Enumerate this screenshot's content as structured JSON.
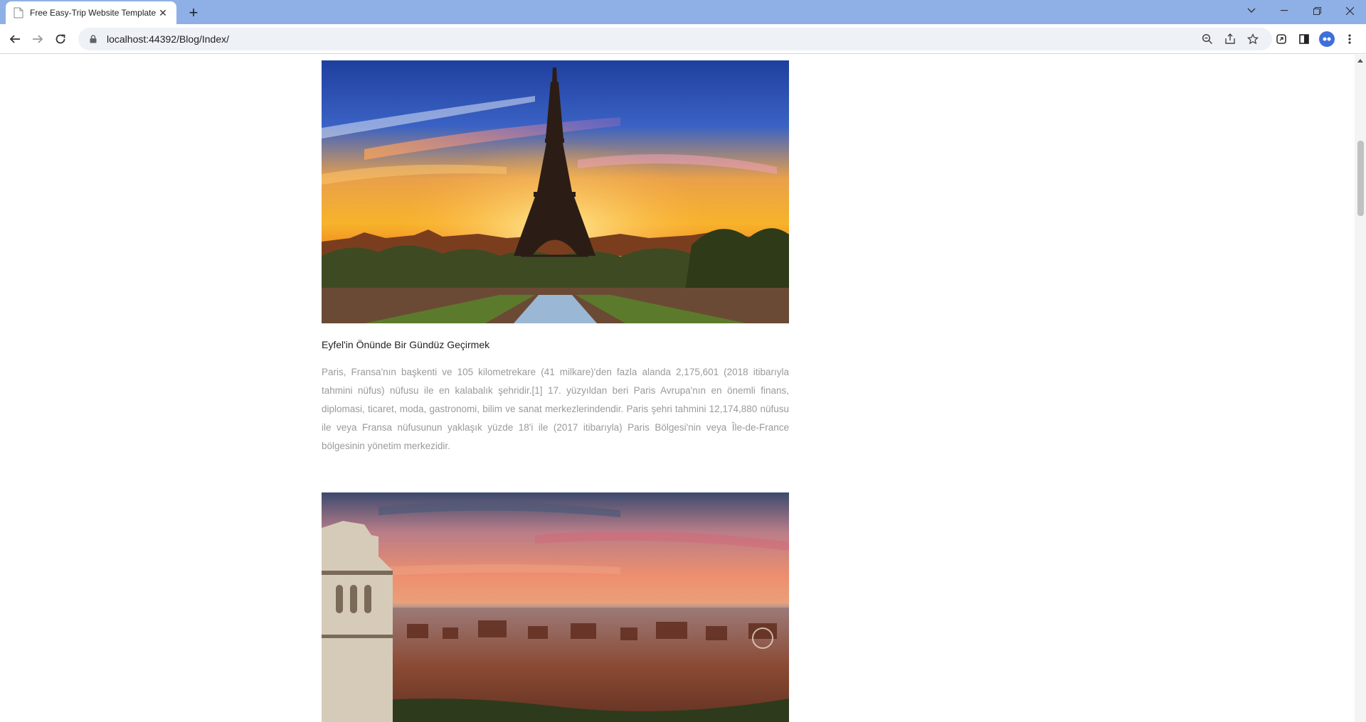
{
  "browser": {
    "tab_title": "Free Easy-Trip Website Template",
    "url": "localhost:44392/Blog/Index/",
    "icons": [
      "favicon-icon",
      "close-icon",
      "plus-icon",
      "chevron-down-icon",
      "minimize-icon",
      "restore-icon",
      "close-window-icon",
      "back-icon",
      "forward-icon",
      "reload-icon",
      "lock-icon",
      "zoom-icon",
      "share-icon",
      "star-icon",
      "extensions-icon",
      "side-panel-icon",
      "profile-icon",
      "menu-icon"
    ]
  },
  "posts": [
    {
      "title": "Eyfel'in Önünde Bir Gündüz Geçirmek",
      "text": "Paris, Fransa'nın başkenti ve 105 kilometrekare (41 milkare)'den fazla alanda 2,175,601 (2018 itibarıyla tahmini nüfus) nüfusu ile en kalabalık şehridir.[1] 17. yüzyıldan beri Paris Avrupa'nın en önemli finans, diplomasi, ticaret, moda, gastronomi, bilim ve sanat merkezlerindendir. Paris şehri tahmini 12,174,880 nüfusu ile veya Fransa nüfusunun yaklaşık yüzde 18'i ile (2017 itibarıyla) Paris Bölgesi'nin veya Île-de-France bölgesinin yönetim merkezidir.",
      "image": "eiffel-tower-sunset-photo"
    },
    {
      "title": "",
      "text": "",
      "image": "city-skyline-sunset-photo"
    }
  ]
}
